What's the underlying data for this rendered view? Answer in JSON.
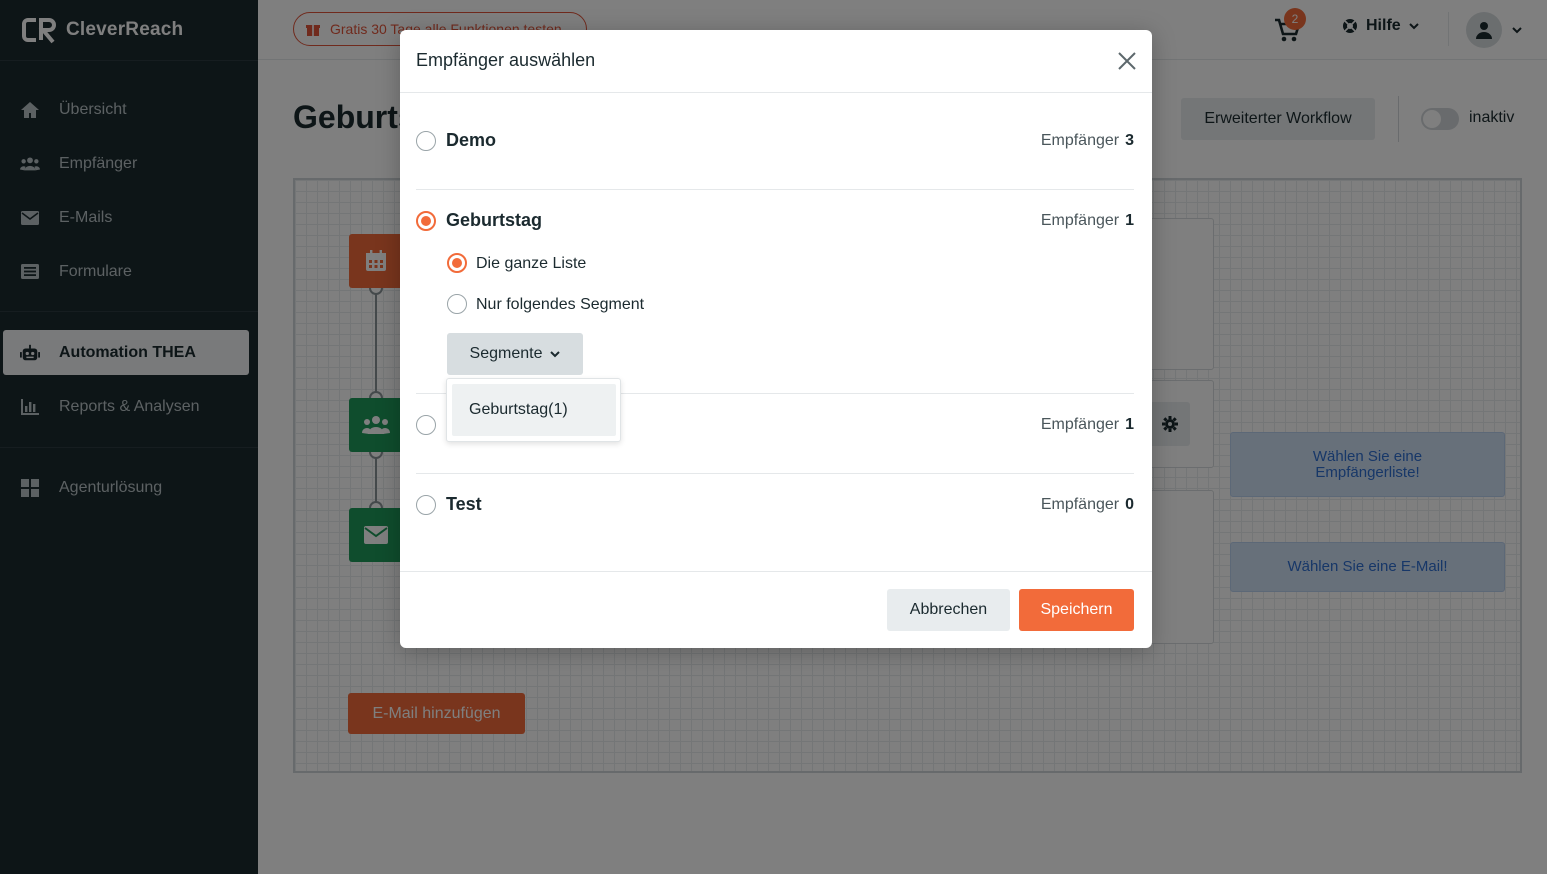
{
  "app": {
    "brand": "CleverReach"
  },
  "sidebar": {
    "items": [
      {
        "label": "Übersicht",
        "icon": "home-icon"
      },
      {
        "label": "Empfänger",
        "icon": "users-icon"
      },
      {
        "label": "E-Mails",
        "icon": "envelope-icon"
      },
      {
        "label": "Formulare",
        "icon": "form-icon"
      },
      {
        "label": "Automation THEA",
        "icon": "robot-icon",
        "active": true
      },
      {
        "label": "Reports & Analysen",
        "icon": "chart-icon"
      },
      {
        "label": "Agenturlösung",
        "icon": "grid-icon"
      }
    ]
  },
  "header": {
    "promo": "Gratis 30 Tage alle Funktionen testen",
    "cart_count": "2",
    "help_label": "Hilfe"
  },
  "page": {
    "title": "Geburtstag",
    "workflow_button": "Erweiterter Workflow",
    "status_label": "inaktiv",
    "hint_list": "Wählen Sie eine Empfängerliste!",
    "hint_email": "Wählen Sie eine E-Mail!",
    "add_email_button": "E-Mail hinzufügen"
  },
  "modal": {
    "title": "Empfänger auswählen",
    "count_label": "Empfänger",
    "lists": [
      {
        "name": "Demo",
        "count": "3",
        "selected": false
      },
      {
        "name": "Geburtstag",
        "count": "1",
        "selected": true
      },
      {
        "name": "",
        "count": "1",
        "selected": false
      },
      {
        "name": "Test",
        "count": "0",
        "selected": false
      }
    ],
    "options": {
      "whole_list": "Die ganze Liste",
      "segment_only": "Nur folgendes Segment"
    },
    "segments_button": "Segmente",
    "segment_items": [
      "Geburtstag(1)"
    ],
    "cancel_label": "Abbrechen",
    "save_label": "Speichern"
  },
  "colors": {
    "accent": "#f26b3a",
    "sidebar_bg": "#1b2a2f",
    "green_node": "#1e9b5a",
    "hint_blue": "#2f6fd0"
  }
}
